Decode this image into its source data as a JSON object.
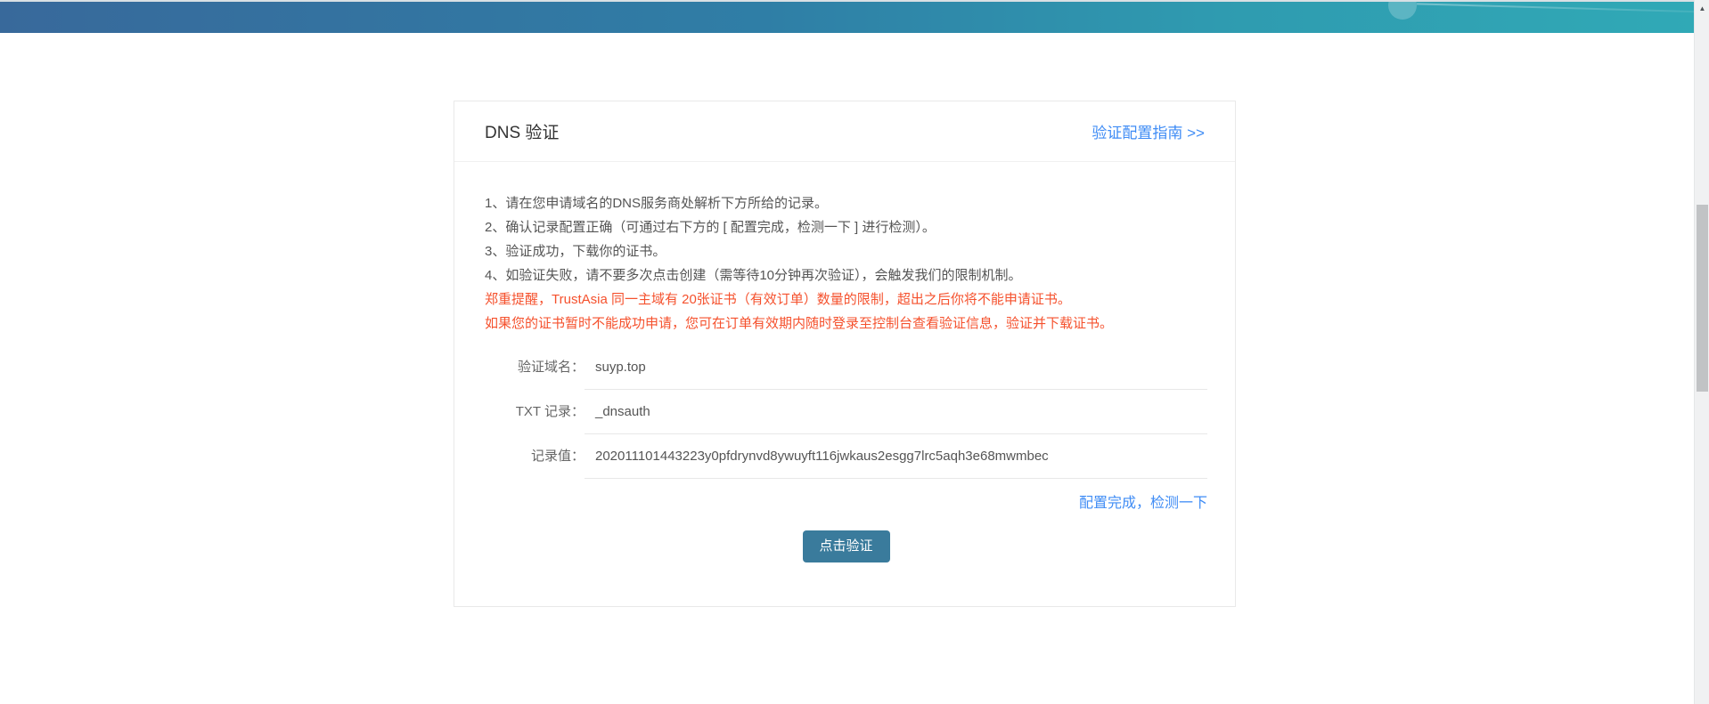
{
  "card": {
    "title": "DNS 验证",
    "guide_link": "验证配置指南 >>",
    "instructions": [
      "1、请在您申请域名的DNS服务商处解析下方所给的记录。",
      "2、确认记录配置正确（可通过右下方的 [ 配置完成，检测一下 ] 进行检测）。",
      "3、验证成功，下载你的证书。",
      "4、如验证失败，请不要多次点击创建（需等待10分钟再次验证），会触发我们的限制机制。"
    ],
    "warnings": [
      "郑重提醒，TrustAsia 同一主域有 20张证书（有效订单）数量的限制，超出之后你将不能申请证书。",
      "如果您的证书暂时不能成功申请，您可在订单有效期内随时登录至控制台查看验证信息，验证并下载证书。"
    ],
    "fields": [
      {
        "label": "验证域名：",
        "value": "suyp.top"
      },
      {
        "label": "TXT 记录：",
        "value": "_dnsauth"
      },
      {
        "label": "记录值：",
        "value": "202011101443223y0pfdrynvd8ywuyft116jwkaus2esgg7lrc5aqh3e68mwmbec"
      }
    ],
    "check_link": "配置完成，检测一下",
    "verify_button": "点击验证"
  },
  "scrollbar": {
    "up_arrow": "▲"
  },
  "colors": {
    "accent_blue": "#3f8cf5",
    "warning_red": "#f5512d",
    "button_bg": "#3a7b9c",
    "header_gradient_left": "#38699b",
    "header_gradient_right": "#30a9b6"
  }
}
